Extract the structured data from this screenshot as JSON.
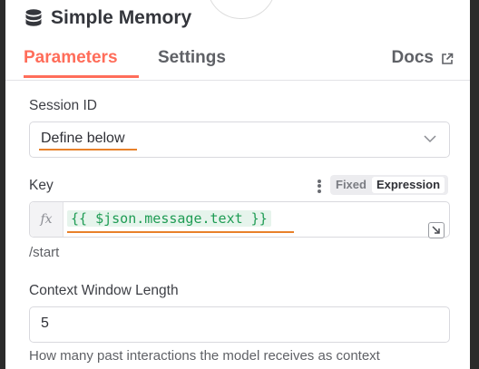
{
  "node": {
    "title": "Simple Memory",
    "icon": "database-icon"
  },
  "tabs": {
    "parameters": "Parameters",
    "settings": "Settings",
    "docs": "Docs"
  },
  "session_id": {
    "label": "Session ID",
    "value": "Define below"
  },
  "key": {
    "label": "Key",
    "mode_fixed": "Fixed",
    "mode_expression": "Expression",
    "expression": "{{ $json.message.text }}",
    "preview": "/start"
  },
  "context_window": {
    "label": "Context Window Length",
    "value": "5",
    "hint": "How many past interactions the model receives as context"
  },
  "colors": {
    "accent": "#ff6d5a",
    "expression_text": "#1f9c54",
    "highlight_underline": "#e8812a"
  }
}
